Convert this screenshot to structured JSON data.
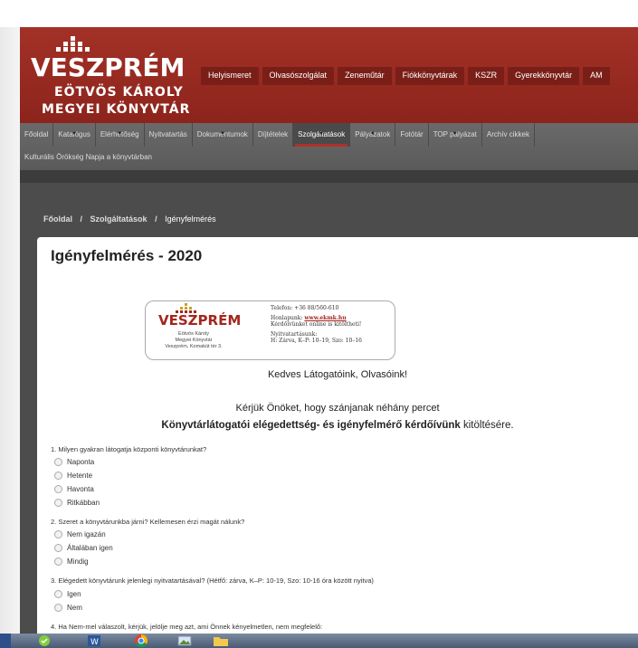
{
  "header": {
    "logo_line1": "VESZPRÉM",
    "logo_line2": "EÖTVÖS KÁROLY",
    "logo_line3": "MEGYEI KÖNYVTÁR"
  },
  "topnav": [
    "Helyismeret",
    "Olvasószolgálat",
    "Zeneműtár",
    "Fiókkönyvtárak",
    "KSZR",
    "Gyerekkönyvtár",
    "AM"
  ],
  "menu": {
    "items": [
      "Főoldal",
      "Katalógus",
      "Elérhetőség",
      "Nyitvatartás",
      "Dokumentumok",
      "Díjtételek",
      "Szolgáltatások",
      "Pályázatok",
      "Fotótár",
      "TOP pályázat",
      "Archív cikkek"
    ],
    "active": "Szolgáltatások",
    "row2": "Kulturális Örökség Napja a könyvtárban"
  },
  "breadcrumb": {
    "home": "Főoldal",
    "section": "Szolgáltatások",
    "current": "Igényfelmérés",
    "sep": "/"
  },
  "page": {
    "title": "Igényfelmérés - 2020",
    "card": {
      "name": "VESZPRÉM",
      "sub1": "Eötvös Károly",
      "sub2": "Megyei Könyvtár",
      "sub3": "Veszprém, Komakút tér 3.",
      "phone": "Telefon: +36 88/560-610",
      "web_label": "Honlapunk:",
      "web": "www.ekmk.hu",
      "web_note": "Kérdőívünket online is kitöltheti!",
      "hours_label": "Nyitvatartásunk:",
      "hours": "H: Zárva, K–P: 10–19, Szo: 10–16"
    },
    "greeting": "Kedves Látogatóink, Olvasóink!",
    "request": "Kérjük Önöket, hogy szánjanak néhány percet",
    "request_bold": "Könyvtárlátogatói elégedettség- és igényfelmérő kérdőívünk",
    "request_end": " kitöltésére."
  },
  "questions": [
    {
      "text": "1. Milyen gyakran látogatja központi könyvtárunkat?",
      "options": [
        "Naponta",
        "Hetente",
        "Havonta",
        "Ritkábban"
      ]
    },
    {
      "text": "2. Szeret a könyvtárunkba járni? Kellemesen érzi magát nálunk?",
      "options": [
        "Nem igazán",
        "Általában igen",
        "Mindig"
      ]
    },
    {
      "text": "3. Elégedett könyvtárunk jelenlegi nyitvatartásával? (Hétfő: zárva, K–P: 10-19, Szo: 10-16 óra között nyitva)",
      "options": [
        "Igen",
        "Nem"
      ]
    },
    {
      "text": "4. Ha Nem-mel válaszolt, kérjük, jelölje meg azt, ami Önnek kényelmetlen, nem megfelelő:",
      "options": []
    }
  ],
  "colors": {
    "header_red": "#a33127",
    "menu_gray": "#5f5f5f",
    "accent": "#b0312a"
  }
}
